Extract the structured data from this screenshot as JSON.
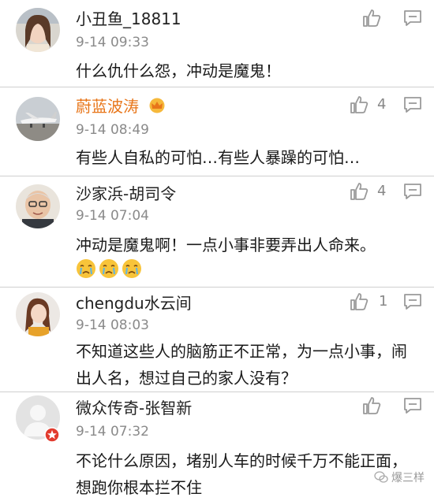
{
  "comments": [
    {
      "name": "小丑鱼_18811",
      "time": "9-14 09:33",
      "text": "什么仇什么怨，冲动是魔鬼！",
      "likes": "",
      "vip": false,
      "avatar": "girl-selfie"
    },
    {
      "name": "蔚蓝波涛",
      "time": "9-14 08:49",
      "text": "有些人自私的可怕…有些人暴躁的可怕…",
      "likes": "4",
      "vip": true,
      "avatar": "airplane"
    },
    {
      "name": "沙家浜-胡司令",
      "time": "9-14 07:04",
      "text": "冲动是魔鬼啊！一点小事非要弄出人命来。",
      "likes": "4",
      "vip": false,
      "avatar": "old-man",
      "emojis": [
        "crying-face",
        "crying-face",
        "crying-face"
      ]
    },
    {
      "name": "chengdu水云间",
      "time": "9-14 08:03",
      "text": "不知道这些人的脑筋正不正常，为一点小事，闹出人名，想过自己的家人没有？",
      "likes": "1",
      "vip": false,
      "avatar": "woman-portrait"
    },
    {
      "name": "微众传奇-张智新",
      "time": "9-14 07:32",
      "text": "不论什么原因，堵别人车的时候千万不能正面，想跑你根本拦不住",
      "likes": "",
      "vip": false,
      "avatar": "default-user"
    }
  ],
  "watermark": "爆三样",
  "colors": {
    "vip_name": "#e8761a",
    "time": "#8a8a8a",
    "separator": "#cfcfcf",
    "icon": "#9a9a9a"
  }
}
